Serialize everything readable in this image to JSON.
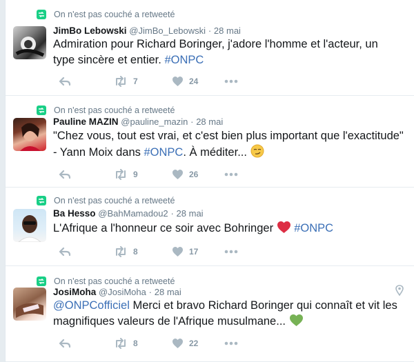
{
  "tweets": [
    {
      "retweet_context": "On n'est pas couché a retweeté",
      "fullname": "JimBo Lebowski",
      "handle": "@JimBo_Lebowski",
      "separator": "·",
      "time": "28 mai",
      "text_plain": "Admiration pour Richard Boringer, j'adore l'homme et l'acteur, un type sincère et entier. ",
      "hashtag": "#ONPC",
      "retweets": "7",
      "likes": "24"
    },
    {
      "retweet_context": "On n'est pas couché a retweeté",
      "fullname": "Pauline MAZIN",
      "handle": "@pauline_mazin",
      "separator": "·",
      "time": "28 mai",
      "text_before": "\"Chez vous, tout est vrai, et c'est bien plus important que l'exactitude\" - Yann Moix dans ",
      "hashtag": "#ONPC",
      "text_after": ". À méditer...",
      "retweets": "9",
      "likes": "26"
    },
    {
      "retweet_context": "On n'est pas couché a retweeté",
      "fullname": "Ba Hesso",
      "handle": "@BahMamadou2",
      "separator": "·",
      "time": "28 mai",
      "text_before": "L'Afrique a l'honneur ce soir avec  Bohringer ",
      "hashtag": "#ONPC",
      "retweets": "8",
      "likes": "17"
    },
    {
      "retweet_context": "On n'est pas couché a retweeté",
      "fullname": "JosiMoha",
      "handle": "@JosiMoha",
      "separator": "·",
      "time": "28 mai",
      "mention": "@ONPCofficiel",
      "text_after": " Merci et bravo Richard Boringer qui connaît et vit les magnifiques valeurs de l'Afrique musulmane... ",
      "retweets": "8",
      "likes": "22"
    }
  ],
  "colors": {
    "retweet_green": "#19cf86",
    "link_blue": "#3b6fb6",
    "meta_gray": "#657786",
    "action_gray": "#aab8c2"
  },
  "icons": {
    "retweet_context": "retweet-icon",
    "reply": "reply-icon",
    "retweet": "retweet-icon",
    "like": "heart-icon",
    "more": "more-dots-icon",
    "location": "location-pin-icon",
    "emoji_smirk": "smirking-face-emoji",
    "emoji_red_heart": "red-heart-emoji",
    "emoji_green_heart": "green-heart-emoji"
  }
}
